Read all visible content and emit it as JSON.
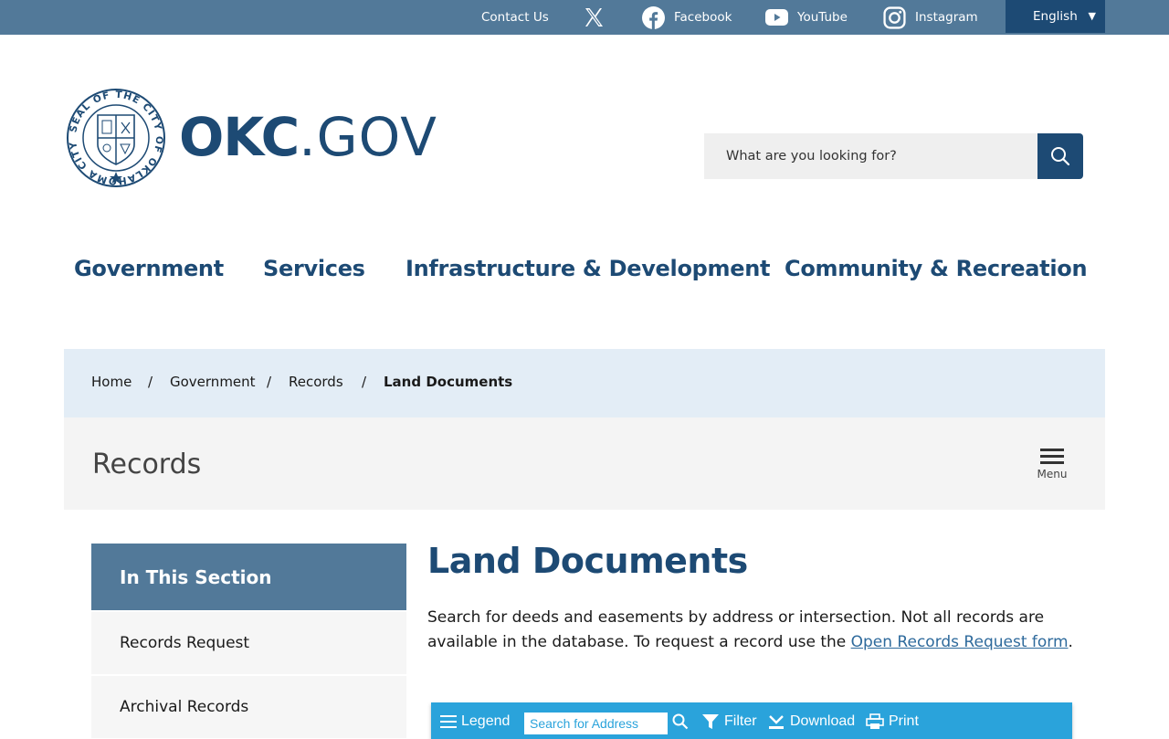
{
  "topbar": {
    "contact": "Contact Us",
    "x_icon": "x-logo-icon",
    "facebook": "Facebook",
    "youtube": "YouTube",
    "instagram": "Instagram",
    "language": "English"
  },
  "header": {
    "logo_okc": "OKC",
    "logo_gov": ".GOV",
    "seal_text": "SEAL OF THE CITY OF OKLAHOMA CITY",
    "search_placeholder": "What are you looking for?"
  },
  "nav": {
    "items": [
      {
        "label": "Government"
      },
      {
        "label": "Services"
      },
      {
        "label": "Infrastructure & Development"
      },
      {
        "label": "Community & Recreation"
      }
    ]
  },
  "breadcrumb": {
    "items": [
      "Home",
      "Government",
      "Records",
      "Land Documents"
    ],
    "separator": "/"
  },
  "section": {
    "title": "Records",
    "menu_label": "Menu"
  },
  "sidebar": {
    "heading": "In This Section",
    "items": [
      {
        "label": "Records Request"
      },
      {
        "label": "Archival Records"
      }
    ]
  },
  "content": {
    "title": "Land Documents",
    "para_before": "Search for deeds and easements by address or intersection. Not all records are available in the database. To request a record use the ",
    "para_link": "Open Records Request form",
    "para_after": "."
  },
  "map_toolbar": {
    "legend": "Legend",
    "search_placeholder": "Search for Address",
    "filter": "Filter",
    "download": "Download",
    "print": "Print"
  },
  "colors": {
    "topbar": "#527999",
    "brand_navy": "#1d4a74",
    "breadcrumb_bg": "#e3edf6",
    "map_toolbar": "#2aa3db"
  }
}
